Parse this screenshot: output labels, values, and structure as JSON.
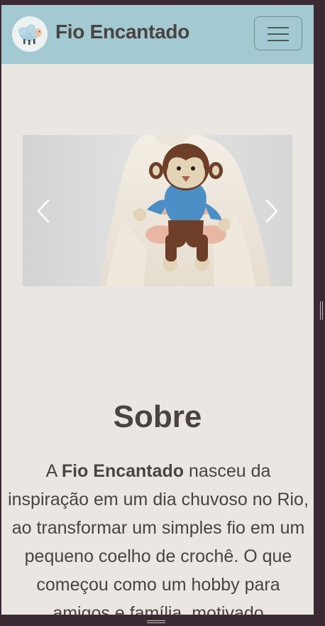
{
  "navbar": {
    "brand": "Fio Encantado",
    "logo_icon": "sheep-icon",
    "menu_icon": "hamburger-icon"
  },
  "carousel": {
    "prev_icon": "chevron-left-icon",
    "next_icon": "chevron-right-icon",
    "slide_description_icon": "crochet-monkey-photo"
  },
  "about": {
    "title": "Sobre",
    "text_prefix": "A ",
    "text_bold": "Fio Encantado",
    "text_rest": " nasceu da inspiração em um dia chuvoso no Rio, ao transformar um simples fio em um pequeno coelho de crochê. O que começou como um hobby para amigos e família, motivado"
  },
  "colors": {
    "navbar": "#a3cad2",
    "page_background": "#eae7e3",
    "text": "#4a4340",
    "window_frame": "#3b2a33"
  }
}
